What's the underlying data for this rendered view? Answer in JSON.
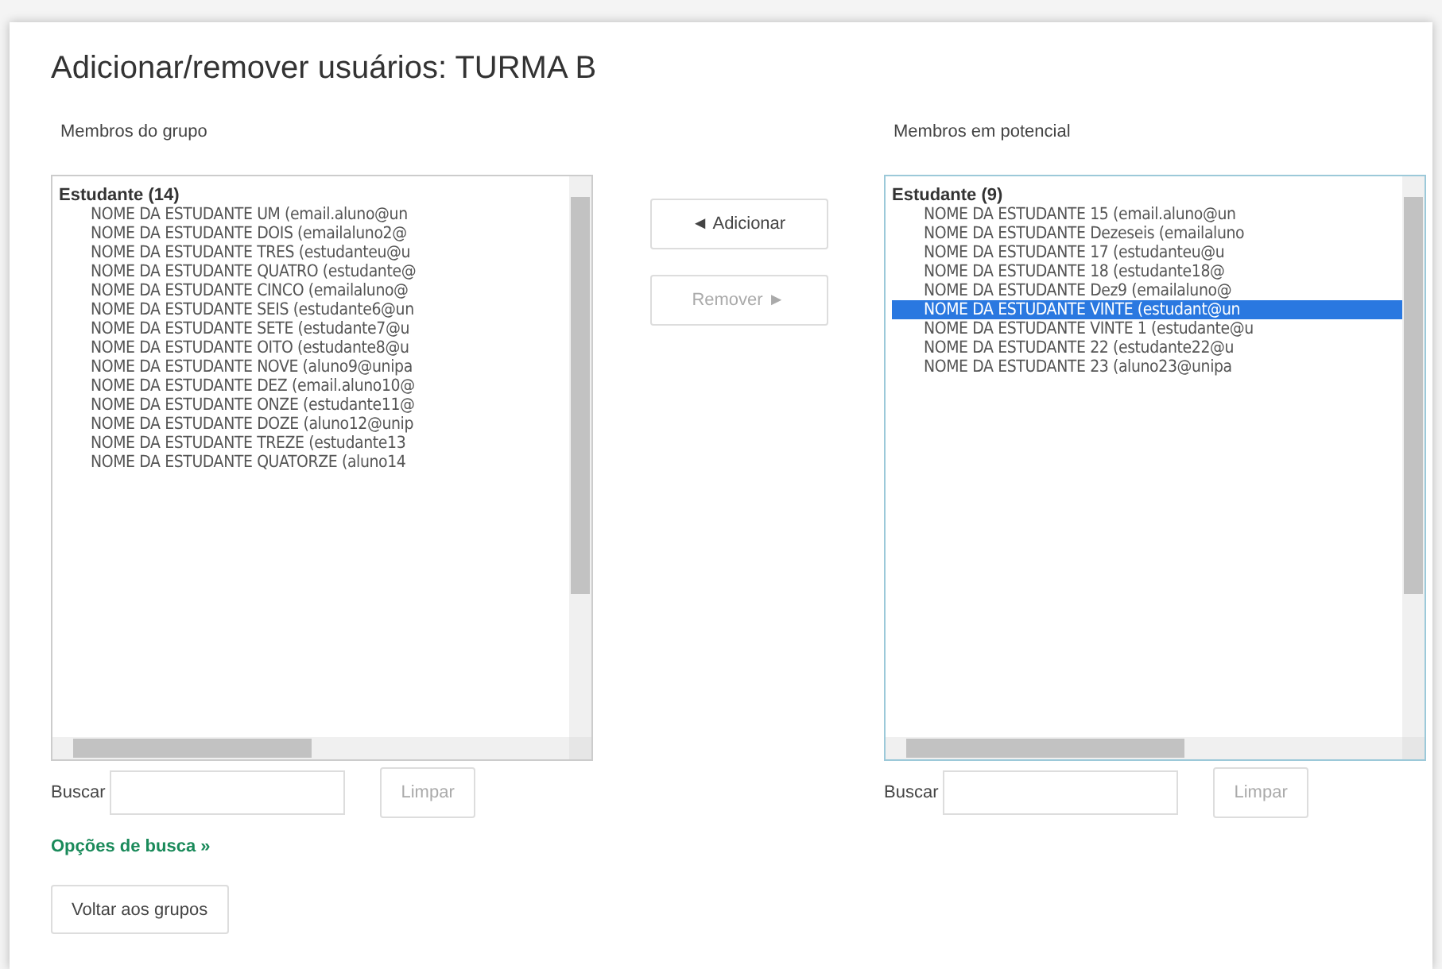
{
  "title": "Adicionar/remover usuários: TURMA B",
  "group_members": {
    "label": "Membros do grupo",
    "group": "Estudante (14)",
    "options": [
      {
        "text": "NOME DA ESTUDANTE UM (email.aluno@un",
        "selected": false
      },
      {
        "text": "NOME DA ESTUDANTE DOIS  (emailaluno2@",
        "selected": false
      },
      {
        "text": "NOME DA ESTUDANTE TRES  (estudanteu@u",
        "selected": false
      },
      {
        "text": "NOME DA ESTUDANTE QUATRO (estudante@",
        "selected": false
      },
      {
        "text": "NOME DA ESTUDANTE CINCO (emailaluno@",
        "selected": false
      },
      {
        "text": "NOME DA ESTUDANTE SEIS (estudante6@un",
        "selected": false
      },
      {
        "text": "NOME DA ESTUDANTE SETE  (estudante7@u",
        "selected": false
      },
      {
        "text": "NOME DA ESTUDANTE OITO  (estudante8@u",
        "selected": false
      },
      {
        "text": "NOME DA ESTUDANTE NOVE  (aluno9@unipa",
        "selected": false
      },
      {
        "text": "NOME DA ESTUDANTE DEZ  (email.aluno10@",
        "selected": false
      },
      {
        "text": "NOME DA ESTUDANTE ONZE  (estudante11@",
        "selected": false
      },
      {
        "text": "NOME DA ESTUDANTE DOZE (aluno12@unip",
        "selected": false
      },
      {
        "text": "NOME DA ESTUDANTE TREZE (estudante13",
        "selected": false
      },
      {
        "text": "NOME DA ESTUDANTE QUATORZE (aluno14",
        "selected": false
      }
    ],
    "search_label": "Buscar",
    "clear_button": {
      "label": "Limpar",
      "disabled": true
    }
  },
  "actions": [
    {
      "label": "◄ Adicionar",
      "disabled": false
    },
    {
      "label": "Remover ►",
      "disabled": true
    }
  ],
  "potential_members": {
    "label": "Membros em potencial",
    "group": "Estudante (9)",
    "options": [
      {
        "text": "NOME DA ESTUDANTE 15 (email.aluno@un",
        "selected": false
      },
      {
        "text": "NOME DA ESTUDANTE Dezeseis (emailaluno",
        "selected": false
      },
      {
        "text": "NOME DA ESTUDANTE 17 (estudanteu@u",
        "selected": false
      },
      {
        "text": "NOME DA ESTUDANTE 18 (estudante18@",
        "selected": false
      },
      {
        "text": "NOME DA ESTUDANTE Dez9 (emailaluno@",
        "selected": false
      },
      {
        "text": "NOME DA ESTUDANTE VINTE (estudant@un",
        "selected": true
      },
      {
        "text": "NOME DA ESTUDANTE VINTE 1 (estudante@u",
        "selected": false
      },
      {
        "text": "NOME DA ESTUDANTE 22 (estudante22@u",
        "selected": false
      },
      {
        "text": "NOME DA ESTUDANTE 23 (aluno23@unipa",
        "selected": false
      }
    ],
    "search_label": "Buscar",
    "clear_button": {
      "label": "Limpar",
      "disabled": true
    }
  },
  "search_options_link": "Opções de busca »",
  "back_button": "Voltar aos grupos"
}
